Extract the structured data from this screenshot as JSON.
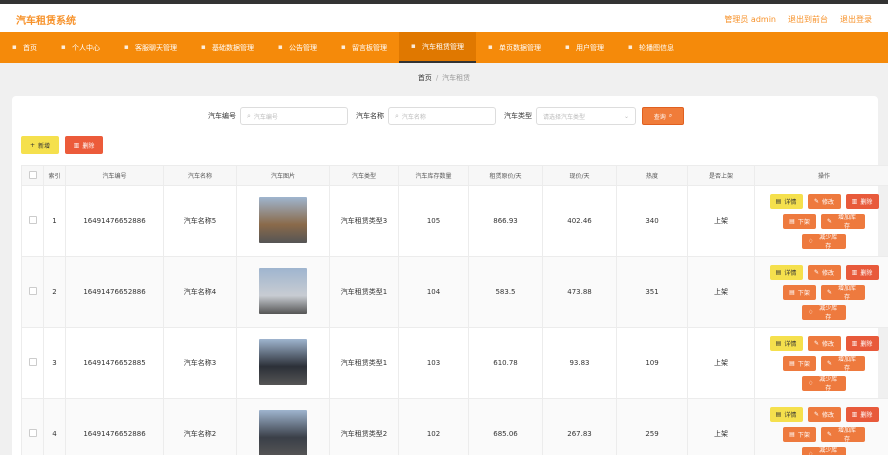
{
  "header": {
    "brand": "汽车租赁系统",
    "admin": "管理员 admin",
    "back": "退出到前台",
    "logout": "退出登录"
  },
  "nav": [
    {
      "label": "首页",
      "icon": "home-icon"
    },
    {
      "label": "个人中心",
      "icon": "user-icon"
    },
    {
      "label": "客服聊天管理",
      "icon": "chat-icon"
    },
    {
      "label": "基础数据管理",
      "icon": "data-icon"
    },
    {
      "label": "公告管理",
      "icon": "notice-icon"
    },
    {
      "label": "留言板管理",
      "icon": "message-icon"
    },
    {
      "label": "汽车租赁管理",
      "icon": "car-icon"
    },
    {
      "label": "单页数据管理",
      "icon": "page-icon"
    },
    {
      "label": "用户管理",
      "icon": "users-icon"
    },
    {
      "label": "轮播图信息",
      "icon": "image-icon"
    }
  ],
  "breadcrumb": {
    "home": "首页",
    "sep": "/",
    "current": "汽车租赁"
  },
  "filter": {
    "no_label": "汽车编号",
    "no_placeholder": "汽车编号",
    "name_label": "汽车名称",
    "name_placeholder": "汽车名称",
    "type_label": "汽车类型",
    "type_placeholder": "请选择汽车类型",
    "search": "查询"
  },
  "actions": {
    "add": "新增",
    "delete": "删除"
  },
  "table": {
    "headers": [
      "索引",
      "汽车编号",
      "汽车名称",
      "汽车图片",
      "汽车类型",
      "汽车库存数量",
      "租赁原价/天",
      "现价/天",
      "热度",
      "是否上架",
      "操作"
    ],
    "ops": {
      "detail": "详情",
      "edit": "修改",
      "delete": "删除",
      "down": "下架",
      "add_stock": "增加库存",
      "reduce_stock": "减少库存"
    },
    "rows": [
      {
        "index": "1",
        "no": "16491476652886",
        "name": "汽车名称5",
        "type": "汽车租赁类型3",
        "stock": "105",
        "price": "866.93",
        "now": "402.46",
        "hot": "340",
        "shelf": "上架",
        "img": "#8a6a4a"
      },
      {
        "index": "2",
        "no": "16491476652886",
        "name": "汽车名称4",
        "type": "汽车租赁类型1",
        "stock": "104",
        "price": "583.5",
        "now": "473.88",
        "hot": "351",
        "shelf": "上架",
        "img": "#c8ccd2"
      },
      {
        "index": "3",
        "no": "16491476652885",
        "name": "汽车名称3",
        "type": "汽车租赁类型1",
        "stock": "103",
        "price": "610.78",
        "now": "93.83",
        "hot": "109",
        "shelf": "上架",
        "img": "#2c3038"
      },
      {
        "index": "4",
        "no": "16491476652886",
        "name": "汽车名称2",
        "type": "汽车租赁类型2",
        "stock": "102",
        "price": "685.06",
        "now": "267.83",
        "hot": "259",
        "shelf": "上架",
        "img": "#3a3f48"
      }
    ]
  }
}
